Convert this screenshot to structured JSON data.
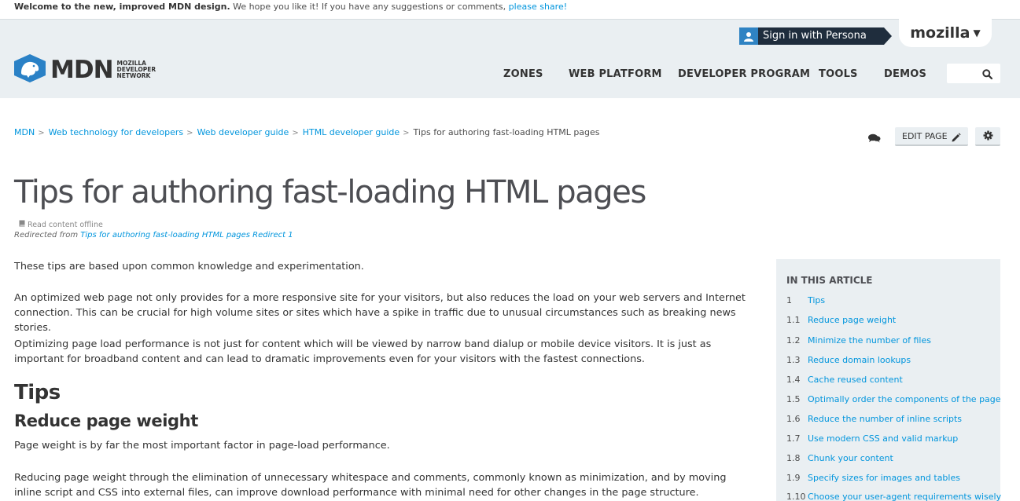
{
  "notice": {
    "bold": "Welcome to the new, improved MDN design.",
    "text": " We hope you like it! If you have any suggestions or comments, ",
    "link": "please share!"
  },
  "header": {
    "persona_label": "Sign in with Persona",
    "mozilla_label": "mozilla",
    "logo_word": "MDN",
    "logo_sub_1": "Mozilla",
    "logo_sub_2": "Developer",
    "logo_sub_3": "Network",
    "nav": [
      "ZONES",
      "WEB PLATFORM",
      "DEVELOPER PROGRAM",
      "TOOLS",
      "DEMOS"
    ]
  },
  "breadcrumb": {
    "items": [
      "MDN",
      "Web technology for developers",
      "Web developer guide",
      "HTML developer guide"
    ],
    "current": "Tips for authoring fast-loading HTML pages"
  },
  "toolbar": {
    "edit_label": "EDIT PAGE"
  },
  "article": {
    "title": "Tips for authoring fast-loading HTML pages",
    "offline_label": "Read content offline",
    "redirect_prefix": "Redirected from ",
    "redirect_link": "Tips for authoring fast-loading HTML pages Redirect 1",
    "p1": "These tips are based upon common knowledge and experimentation.",
    "p2": "An optimized web page not only provides for a more responsive site for your visitors, but also reduces the load on your web servers and Internet connection. This can be crucial for high volume sites or sites which have a spike in traffic due to unusual circumstances such as breaking news stories.",
    "p3": "Optimizing page load performance is not just for content which will be viewed by narrow band dialup or mobile device visitors. It is just as important for broadband content and can lead to dramatic improvements even for your visitors with the fastest connections.",
    "h_tips": "Tips",
    "h_reduce": "Reduce page weight",
    "p4": "Page weight is by far the most important factor in page-load performance.",
    "p5": "Reducing page weight through the elimination of unnecessary whitespace and comments, commonly known as minimization, and by moving inline script and CSS into external files, can improve download performance with minimal need for other changes in the page structure."
  },
  "toc": {
    "heading": "IN THIS ARTICLE",
    "items": [
      {
        "num": "1",
        "label": "Tips"
      },
      {
        "num": "1.1",
        "label": "Reduce page weight"
      },
      {
        "num": "1.2",
        "label": "Minimize the number of files"
      },
      {
        "num": "1.3",
        "label": "Reduce domain lookups"
      },
      {
        "num": "1.4",
        "label": "Cache reused content"
      },
      {
        "num": "1.5",
        "label": "Optimally order the components of the page"
      },
      {
        "num": "1.6",
        "label": "Reduce the number of inline scripts"
      },
      {
        "num": "1.7",
        "label": "Use modern CSS and valid markup"
      },
      {
        "num": "1.8",
        "label": "Chunk your content"
      },
      {
        "num": "1.9",
        "label": "Specify sizes for images and tables"
      },
      {
        "num": "1.10",
        "label": "Choose your user-agent requirements wisely"
      }
    ]
  },
  "colors": {
    "link": "#0095dd",
    "header_bg": "#eaeff2",
    "persona_bg": "#1f2d3d",
    "persona_icon_bg": "#2f83c3",
    "logo_blue": "#2a81c6"
  },
  "icons": {
    "persona": "user-icon",
    "search": "search-icon",
    "comment": "comments-icon",
    "edit": "pencil-icon",
    "settings": "gear-icon",
    "offline": "book-icon",
    "logo": "mdn-dino-logo"
  }
}
